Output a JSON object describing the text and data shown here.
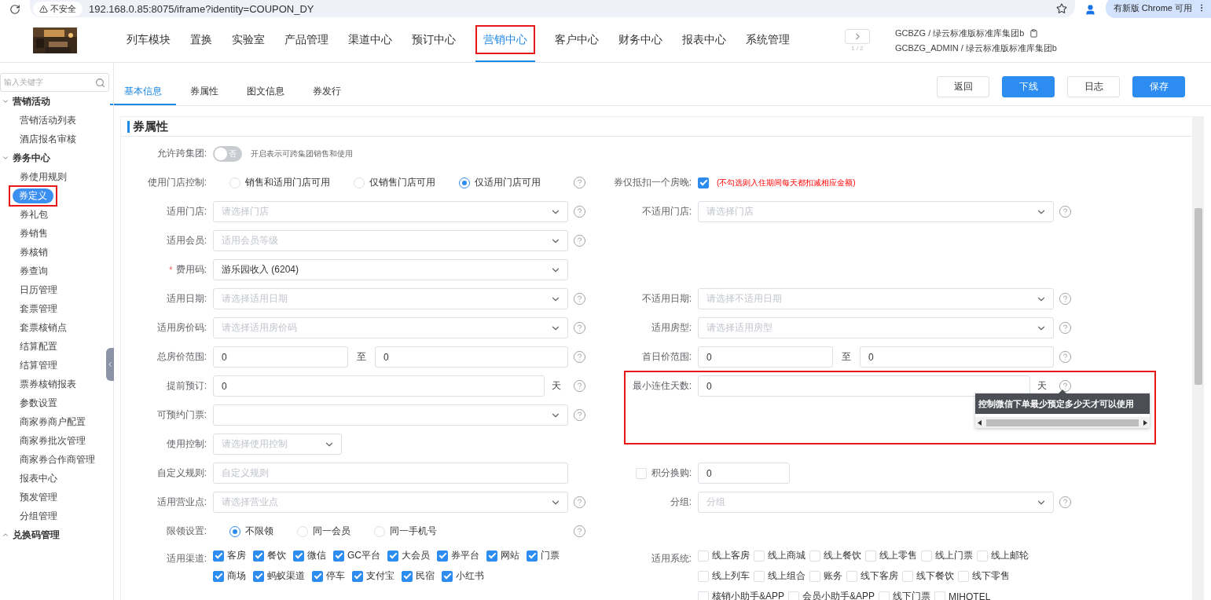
{
  "browser": {
    "security": "不安全",
    "url": "192.168.0.85:8075/iframe?identity=COUPON_DY",
    "update": "有新版 Chrome 可用"
  },
  "header": {
    "logo": {
      "kind": "picture"
    },
    "nav": [
      {
        "label": "列车模块",
        "selected": false,
        "highlighted": false
      },
      {
        "label": "置换",
        "selected": false,
        "highlighted": false
      },
      {
        "label": "实验室",
        "selected": false,
        "highlighted": false
      },
      {
        "label": "产品管理",
        "selected": false,
        "highlighted": false
      },
      {
        "label": "渠道中心",
        "selected": false,
        "highlighted": false
      },
      {
        "label": "预订中心",
        "selected": false,
        "highlighted": false
      },
      {
        "label": "营销中心",
        "selected": true,
        "highlighted": true
      },
      {
        "label": "客户中心",
        "selected": false,
        "highlighted": false
      },
      {
        "label": "财务中心",
        "selected": false,
        "highlighted": false
      },
      {
        "label": "报表中心",
        "selected": false,
        "highlighted": false
      },
      {
        "label": "系统管理",
        "selected": false,
        "highlighted": false
      }
    ],
    "pager": "1 / 2",
    "user_lines": [
      "GCBZG / 绿云标准版标准库集团b",
      "GCBZG_ADMIN / 绿云标准版标准库集团b"
    ]
  },
  "sidebar": {
    "search_placeholder": "输入关键字",
    "groups": [
      {
        "label": "营销活动",
        "expanded": true,
        "children": [
          {
            "label": "营销活动列表",
            "selected": false,
            "highlighted": false
          },
          {
            "label": "酒店报名审核",
            "selected": false,
            "highlighted": false
          }
        ]
      },
      {
        "label": "券务中心",
        "expanded": true,
        "children": [
          {
            "label": "券使用规则",
            "selected": false,
            "highlighted": false
          },
          {
            "label": "券定义",
            "selected": true,
            "highlighted": true
          },
          {
            "label": "券礼包",
            "selected": false,
            "highlighted": false
          },
          {
            "label": "券销售",
            "selected": false,
            "highlighted": false
          },
          {
            "label": "券核销",
            "selected": false,
            "highlighted": false
          },
          {
            "label": "券查询",
            "selected": false,
            "highlighted": false
          },
          {
            "label": "日历管理",
            "selected": false,
            "highlighted": false
          },
          {
            "label": "套票管理",
            "selected": false,
            "highlighted": false
          },
          {
            "label": "套票核销点",
            "selected": false,
            "highlighted": false
          },
          {
            "label": "结算配置",
            "selected": false,
            "highlighted": false
          },
          {
            "label": "结算管理",
            "selected": false,
            "highlighted": false
          },
          {
            "label": "票券核销报表",
            "selected": false,
            "highlighted": false
          },
          {
            "label": "参数设置",
            "selected": false,
            "highlighted": false
          },
          {
            "label": "商家券商户配置",
            "selected": false,
            "highlighted": false
          },
          {
            "label": "商家券批次管理",
            "selected": false,
            "highlighted": false
          },
          {
            "label": "商家券合作商管理",
            "selected": false,
            "highlighted": false
          },
          {
            "label": "报表中心",
            "selected": false,
            "highlighted": false
          },
          {
            "label": "预发管理",
            "selected": false,
            "highlighted": false
          },
          {
            "label": "分组管理",
            "selected": false,
            "highlighted": false
          }
        ]
      },
      {
        "label": "兑换码管理",
        "expanded": false
      }
    ]
  },
  "tabs": [
    {
      "label": "基本信息",
      "selected": true
    },
    {
      "label": "券属性",
      "selected": false
    },
    {
      "label": "图文信息",
      "selected": false
    },
    {
      "label": "券发行",
      "selected": false
    }
  ],
  "actions": [
    {
      "label": "返回",
      "primary": false
    },
    {
      "label": "下线",
      "primary": true
    },
    {
      "label": "日志",
      "primary": false
    },
    {
      "label": "保存",
      "primary": true
    }
  ],
  "section_title": "券属性",
  "rows": [
    {
      "left": {
        "kind": "toggle",
        "label": "允许跨集团:",
        "on": false,
        "text": "否",
        "hint": "开启表示可跨集团销售和使用"
      },
      "right": null
    },
    {
      "left": {
        "kind": "radio",
        "label": "使用门店控制:",
        "help": true,
        "options": [
          {
            "label": "销售和适用门店可用",
            "selected": false
          },
          {
            "label": "仅销售门店可用",
            "selected": false
          },
          {
            "label": "仅适用门店可用",
            "selected": true
          }
        ]
      },
      "right": {
        "kind": "check_note",
        "label": "券仅抵扣一个房晚:",
        "checked": true,
        "note": "(不勾选则入住期间每天都扣减相应金额)"
      }
    },
    {
      "left": {
        "kind": "select",
        "label": "适用门店:",
        "placeholder": "请选择门店",
        "help": true
      },
      "right": {
        "kind": "select",
        "label": "不适用门店:",
        "placeholder": "请选择门店",
        "help": true
      }
    },
    {
      "left": {
        "kind": "select",
        "label": "适用会员:",
        "placeholder": "适用会员等级",
        "help": true
      },
      "right": null
    },
    {
      "left": {
        "kind": "select",
        "label": "费用码:",
        "required_mark": "*",
        "value": "游乐园收入 (6204)",
        "help": false
      },
      "right": null
    },
    {
      "left": {
        "kind": "select",
        "label": "适用日期:",
        "placeholder": "请选择适用日期",
        "help": true
      },
      "right": {
        "kind": "select",
        "label": "不适用日期:",
        "placeholder": "请选择不适用日期",
        "help": true
      }
    },
    {
      "left": {
        "kind": "select",
        "label": "适用房价码:",
        "placeholder": "请选择适用房价码",
        "help": true
      },
      "right": {
        "kind": "select",
        "label": "适用房型:",
        "placeholder": "请选择适用房型",
        "help": true
      }
    },
    {
      "left": {
        "kind": "range",
        "label": "总房价范围:",
        "from": "0",
        "sep": "至",
        "to": "0",
        "help": true
      },
      "right": {
        "kind": "range",
        "label": "首日价范围:",
        "from": "0",
        "sep": "至",
        "to": "0",
        "help": true
      }
    },
    {
      "left": {
        "kind": "unit_input",
        "label": "提前预订:",
        "value": "0",
        "unit": "天",
        "help": true
      },
      "right": {
        "kind": "unit_input",
        "label": "最小连住天数:",
        "value": "0",
        "unit": "天",
        "help": true,
        "highlighted": true,
        "tooltip": "控制微信下单最少预定多少天才可以使用"
      }
    },
    {
      "left": {
        "kind": "select",
        "label": "可预约门票:",
        "help": true
      },
      "right": null
    },
    {
      "left": {
        "kind": "short_select",
        "label": "使用控制:",
        "placeholder": "请选择使用控制",
        "help": false
      },
      "right": null
    },
    {
      "left": {
        "kind": "input",
        "label": "自定义规则:",
        "placeholder": "自定义规则",
        "help": false
      },
      "right": {
        "kind": "check_input",
        "label": "积分换购:",
        "checked": false,
        "value": "0",
        "help": false
      }
    },
    {
      "left": {
        "kind": "select",
        "label": "适用营业点:",
        "placeholder": "请选择营业点",
        "help": true
      },
      "right": {
        "kind": "select",
        "label": "分组:",
        "placeholder": "分组",
        "help": true
      }
    },
    {
      "left": {
        "kind": "radio",
        "label": "限领设置:",
        "help": true,
        "options": [
          {
            "label": "不限领",
            "selected": true
          },
          {
            "label": "同一会员",
            "selected": false
          },
          {
            "label": "同一手机号",
            "selected": false
          }
        ]
      },
      "right": null
    },
    {
      "left": {
        "kind": "checks",
        "label": "适用渠道:",
        "help": false,
        "options": [
          {
            "label": "客房",
            "checked": true
          },
          {
            "label": "餐饮",
            "checked": true
          },
          {
            "label": "微信",
            "checked": true
          },
          {
            "label": "GC平台",
            "checked": true
          },
          {
            "label": "大会员",
            "checked": true
          },
          {
            "label": "券平台",
            "checked": true
          },
          {
            "label": "网站",
            "checked": true
          },
          {
            "label": "门票",
            "checked": true
          },
          {
            "label": "商场",
            "checked": true
          },
          {
            "label": "蚂蚁渠道",
            "checked": true
          },
          {
            "label": "停车",
            "checked": true
          },
          {
            "label": "支付宝",
            "checked": true
          },
          {
            "label": "民宿",
            "checked": true
          },
          {
            "label": "小红书",
            "checked": true
          }
        ]
      },
      "right": {
        "kind": "checks",
        "label": "适用系统:",
        "help": false,
        "options": [
          {
            "label": "线上客房",
            "checked": false
          },
          {
            "label": "线上商城",
            "checked": false
          },
          {
            "label": "线上餐饮",
            "checked": false
          },
          {
            "label": "线上零售",
            "checked": false
          },
          {
            "label": "线上门票",
            "checked": false
          },
          {
            "label": "线上邮轮",
            "checked": false
          },
          {
            "label": "线上列车",
            "checked": false
          },
          {
            "label": "线上组合",
            "checked": false
          },
          {
            "label": "账务",
            "checked": false
          },
          {
            "label": "线下客房",
            "checked": false
          },
          {
            "label": "线下餐饮",
            "checked": false
          },
          {
            "label": "线下零售",
            "checked": false
          },
          {
            "label": "核销小助手&APP",
            "checked": false
          },
          {
            "label": "会员小助手&APP",
            "checked": false
          },
          {
            "label": "线下门票",
            "checked": false
          },
          {
            "label": "MIHOTEL",
            "checked": false
          }
        ]
      }
    }
  ]
}
